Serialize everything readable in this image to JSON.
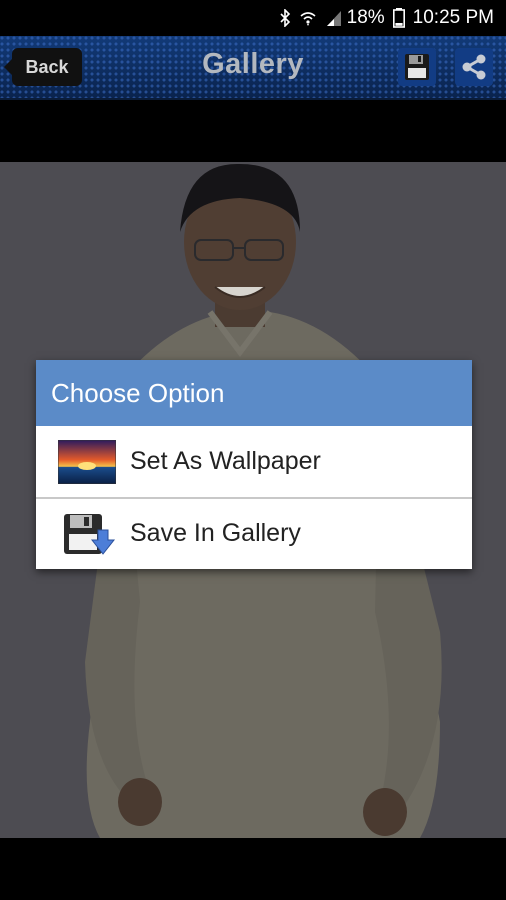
{
  "status_bar": {
    "battery_percent": "18%",
    "time": "10:25 PM"
  },
  "header": {
    "back_label": "Back",
    "title": "Gallery"
  },
  "dialog": {
    "title": "Choose Option",
    "options": [
      {
        "label": "Set As Wallpaper",
        "icon": "wallpaper-icon"
      },
      {
        "label": "Save In Gallery",
        "icon": "save-gallery-icon"
      }
    ]
  },
  "colors": {
    "header_bg": "#0e2f63",
    "dialog_header": "#5b8bc8",
    "dim_overlay": "#4a4a4f"
  }
}
